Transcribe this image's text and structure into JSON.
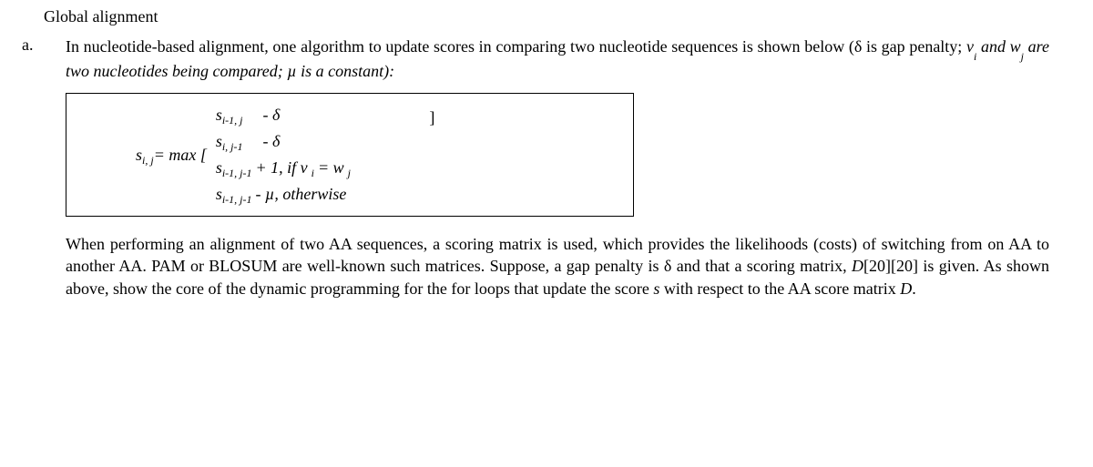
{
  "heading": "Global alignment",
  "marker": "a.",
  "intro_part1": "In nucleotide-based alignment, one algorithm to update scores in comparing two nucleotide sequences is shown below (δ is gap penalty; ",
  "intro_ital1": "v",
  "intro_sub1": "i",
  "intro_ital2": " and w",
  "intro_sub2": "j",
  "intro_ital3": " are two nucleotides being compared; µ is a constant):",
  "formula": {
    "lhs_s": "s",
    "lhs_sub": "i, j",
    "eq_max": " = max [ ",
    "s_label": "s",
    "sub1": "i-1, j",
    "minus_delta": " - δ",
    "sub2": "i, j-1",
    "sub3": "i-1, j-1",
    "plus1": " + 1, if v",
    "vi_sub": "i",
    "eq_wj": "= w",
    "wj_sub": "j",
    "sub4": "i-1, j-1",
    "minus_mu": " - µ, otherwise",
    "rbrack": "]"
  },
  "para2_part1": "When performing an alignment of two AA sequences, a scoring matrix is used, which provides the likelihoods (costs) of switching from on AA to another AA. PAM or BLOSUM are well-known such matrices. Suppose, a gap penalty is δ and that a scoring matrix, ",
  "para2_ital1": "D",
  "para2_part2": "[20][20] is given. As shown above, show the core of the dynamic programming for the for loops that update the score ",
  "para2_ital2": "s",
  "para2_part3": " with respect to the AA score matrix ",
  "para2_ital3": "D",
  "para2_part4": "."
}
